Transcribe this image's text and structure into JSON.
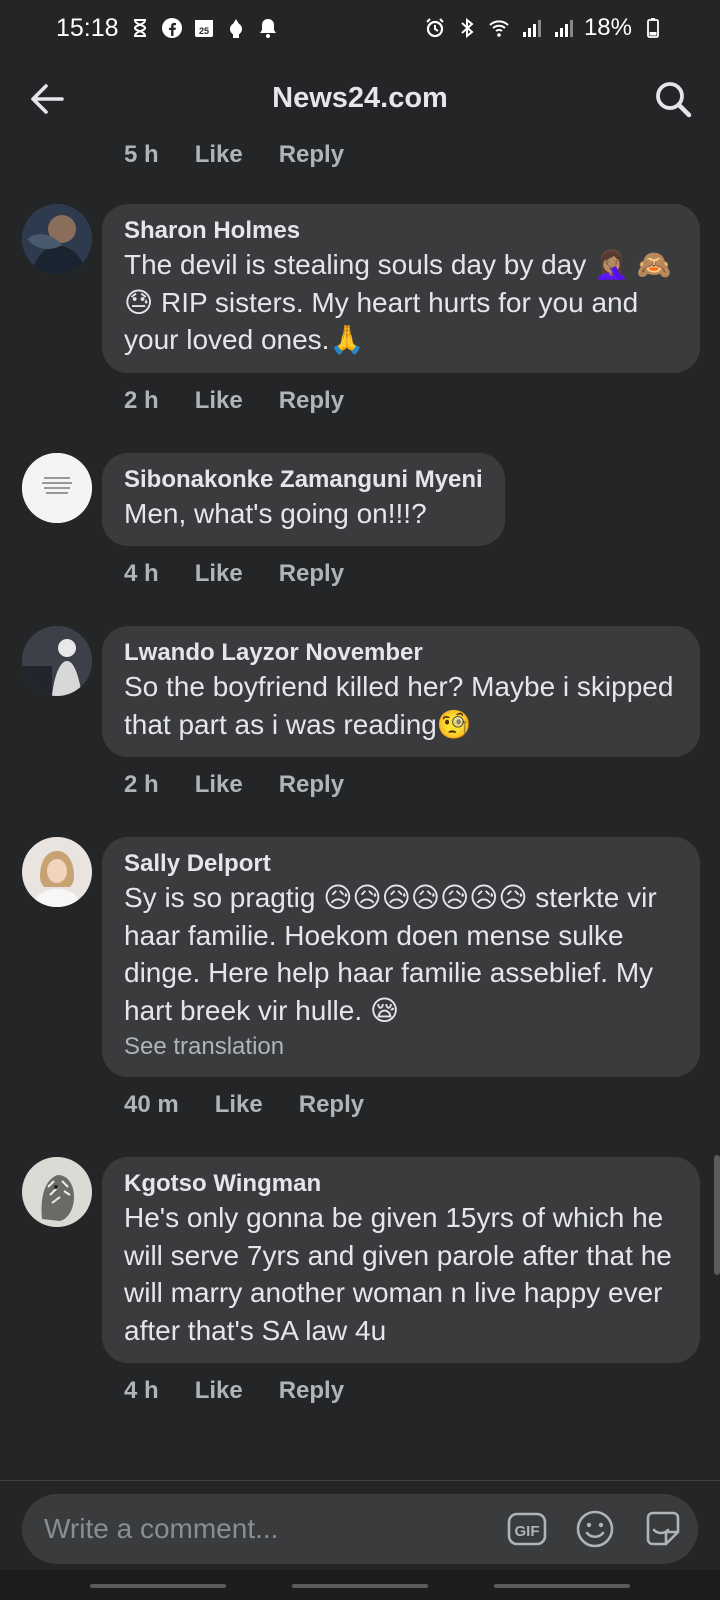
{
  "status_bar": {
    "time": "15:18",
    "battery": "18%",
    "left_icons": [
      "hourglass-icon",
      "facebook-icon",
      "calendar-icon",
      "sonic-icon",
      "bell-icon"
    ],
    "right_icons": [
      "alarm-icon",
      "bluetooth-icon",
      "wifi-icon",
      "signal-icon",
      "signal-icon",
      "battery-icon"
    ]
  },
  "header": {
    "title": "News24.com",
    "back_icon": "arrow-left-icon",
    "search_icon": "search-icon"
  },
  "top_meta": {
    "time": "5 h",
    "like": "Like",
    "reply": "Reply"
  },
  "comments": [
    {
      "author": "Sharon Holmes",
      "text": "The devil is stealing souls day by day 🤦🏽‍♀️ 🙈😓 RIP sisters. My heart hurts for you and your loved ones.🙏",
      "time": "2 h",
      "like": "Like",
      "reply": "Reply"
    },
    {
      "author": "Sibonakonke Zamanguni Myeni",
      "text": "Men, what's going on!!!?",
      "time": "4 h",
      "like": "Like",
      "reply": "Reply"
    },
    {
      "author": "Lwando Layzor November",
      "text": "So the boyfriend killed her? Maybe i skipped that part as i was reading🧐",
      "time": "2 h",
      "like": "Like",
      "reply": "Reply"
    },
    {
      "author": "Sally Delport",
      "text": "Sy is so pragtig 😥😥😥😥😥😥😥 sterkte vir haar familie. Hoekom doen mense sulke dinge. Here help haar familie asseblief. My hart breek vir hulle. 😪",
      "see_translation": "See translation",
      "time": "40 m",
      "like": "Like",
      "reply": "Reply"
    },
    {
      "author": "Kgotso Wingman",
      "text": "He's only gonna be given 15yrs of which he will serve 7yrs and given parole after that he will marry another woman n live happy ever after that's SA law 4u",
      "time": "4 h",
      "like": "Like",
      "reply": "Reply"
    }
  ],
  "composer": {
    "placeholder": "Write a comment...",
    "gif_label": "GIF",
    "icons": [
      "gif-icon",
      "emoji-icon",
      "sticker-icon"
    ]
  },
  "colors": {
    "background": "#242526",
    "bubble": "#3a3b3c",
    "text_primary": "#e4e6eb",
    "text_secondary": "#b0b3b8"
  }
}
